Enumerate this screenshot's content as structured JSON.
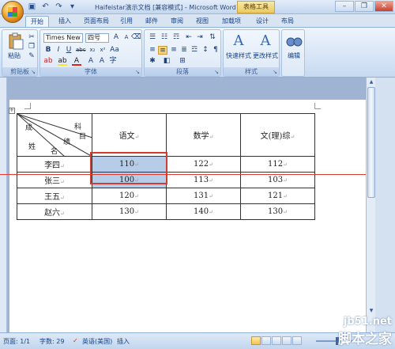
{
  "window": {
    "title": "Haifeistar演示文档 [兼容模式] - Microsoft Word",
    "context_tab_group": "表格工具",
    "controls": [
      "minimize-icon",
      "restore-icon",
      "close-icon"
    ]
  },
  "quick_access": [
    "save-icon",
    "undo-icon",
    "redo-icon",
    "customize-icon"
  ],
  "tabs": [
    {
      "label": "开始",
      "active": true
    },
    {
      "label": "插入",
      "active": false
    },
    {
      "label": "页面布局",
      "active": false
    },
    {
      "label": "引用",
      "active": false
    },
    {
      "label": "邮件",
      "active": false
    },
    {
      "label": "审阅",
      "active": false
    },
    {
      "label": "视图",
      "active": false
    },
    {
      "label": "加载项",
      "active": false
    },
    {
      "label": "设计",
      "active": false
    },
    {
      "label": "布局",
      "active": false
    }
  ],
  "ribbon": {
    "clipboard": {
      "label": "剪贴板",
      "paste": "粘贴"
    },
    "font": {
      "label": "字体",
      "font_name": "Times New R",
      "font_size": "四号"
    },
    "paragraph": {
      "label": "段落"
    },
    "styles": {
      "label": "样式",
      "quick_styles": "快速样式",
      "change_styles": "更改样式"
    },
    "editing": {
      "label": "编辑"
    }
  },
  "table": {
    "header_diag": {
      "top_right_1": "科",
      "top_right_2": "目",
      "top_left": "成",
      "middle": "绩",
      "bottom_left_1": "姓",
      "bottom_left_2": "名"
    },
    "columns": [
      "语文",
      "数学",
      "文(理)综"
    ],
    "rows": [
      {
        "name": "李四",
        "values": [
          "110",
          "122",
          "112"
        ]
      },
      {
        "name": "张三",
        "values": [
          "100",
          "113",
          "103"
        ]
      },
      {
        "name": "王五",
        "values": [
          "120",
          "131",
          "121"
        ]
      },
      {
        "name": "赵六",
        "values": [
          "130",
          "140",
          "130"
        ]
      }
    ],
    "selected_column": 0,
    "selected_rows": [
      0,
      1
    ]
  },
  "status": {
    "page": "页面: 1/1",
    "words": "字数: 29",
    "language": "英语(美国)",
    "mode": "插入"
  },
  "watermark": {
    "line1": "jb51.net",
    "line2": "脚本之家"
  }
}
